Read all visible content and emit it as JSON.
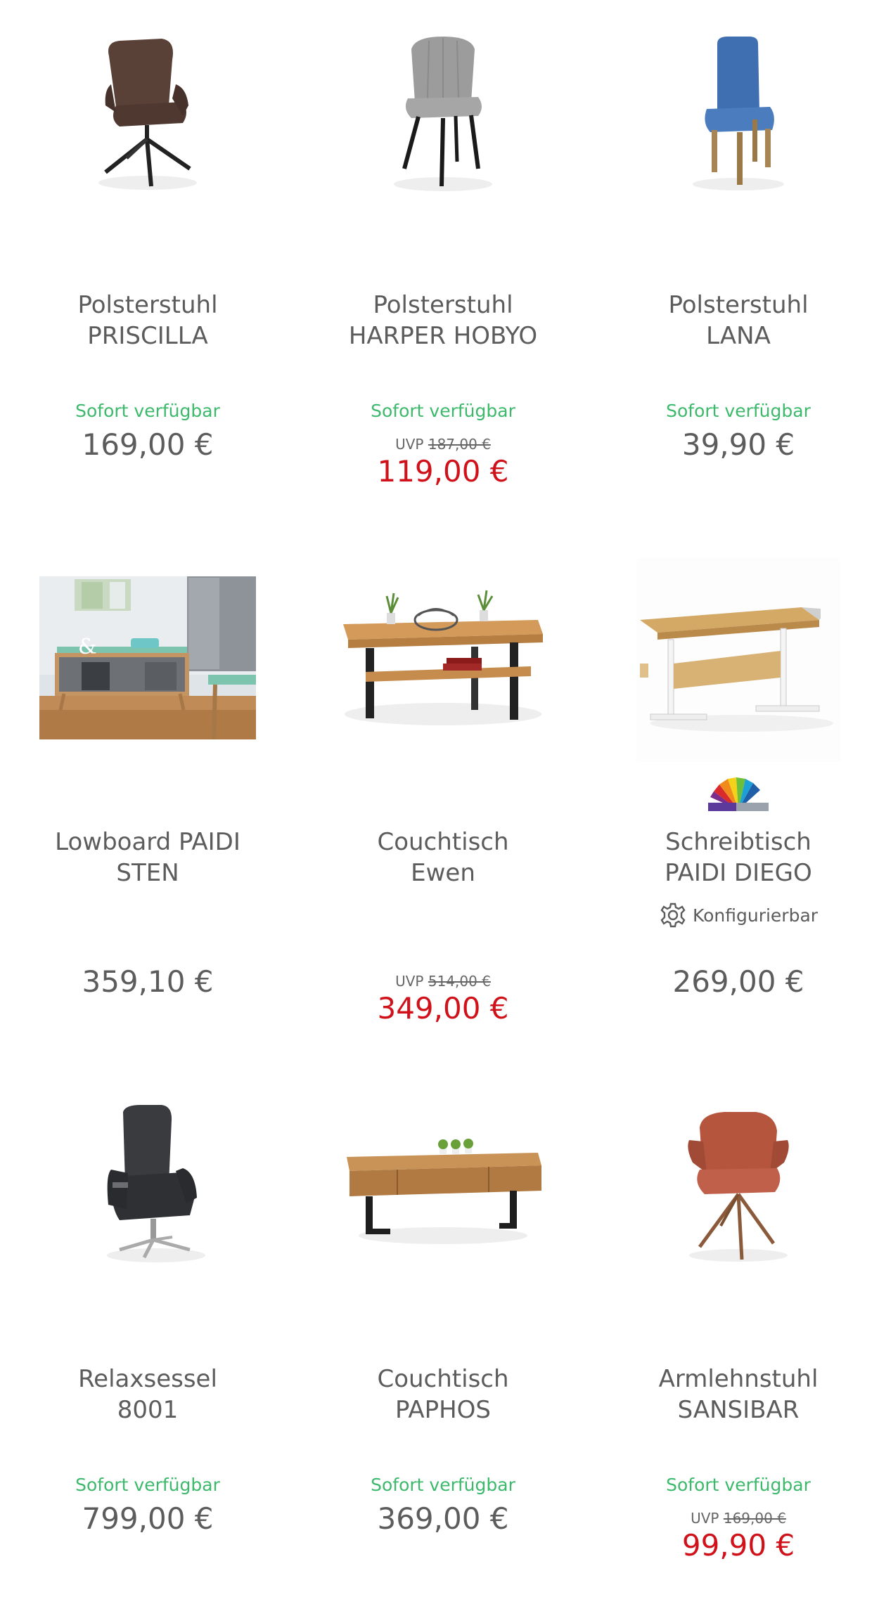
{
  "products": [
    {
      "line1": "Polsterstuhl",
      "line2": "PRISCILLA",
      "availability": "Sofort verfügbar",
      "uvp_label": "",
      "uvp_price": "",
      "price": "169,00 €",
      "sale": false,
      "configurable": ""
    },
    {
      "line1": "Polsterstuhl",
      "line2": "HARPER HOBYO",
      "availability": "Sofort verfügbar",
      "uvp_label": "UVP",
      "uvp_price": "187,00 €",
      "price": "119,00 €",
      "sale": true,
      "configurable": ""
    },
    {
      "line1": "Polsterstuhl",
      "line2": "LANA",
      "availability": "Sofort verfügbar",
      "uvp_label": "",
      "uvp_price": "",
      "price": "39,90 €",
      "sale": false,
      "configurable": ""
    },
    {
      "line1": "Lowboard PAIDI",
      "line2": "STEN",
      "availability": "",
      "uvp_label": "",
      "uvp_price": "",
      "price": "359,10 €",
      "sale": false,
      "configurable": ""
    },
    {
      "line1": "Couchtisch",
      "line2": "Ewen",
      "availability": "",
      "uvp_label": "UVP",
      "uvp_price": "514,00 €",
      "price": "349,00 €",
      "sale": true,
      "configurable": ""
    },
    {
      "line1": "Schreibtisch",
      "line2": "PAIDI DIEGO",
      "availability": "",
      "uvp_label": "",
      "uvp_price": "",
      "price": "269,00 €",
      "sale": false,
      "configurable": "Konfigurierbar"
    },
    {
      "line1": "Relaxsessel",
      "line2": "8001",
      "availability": "Sofort verfügbar",
      "uvp_label": "",
      "uvp_price": "",
      "price": "799,00 €",
      "sale": false,
      "configurable": ""
    },
    {
      "line1": "Couchtisch",
      "line2": "PAPHOS",
      "availability": "Sofort verfügbar",
      "uvp_label": "",
      "uvp_price": "",
      "price": "369,00 €",
      "sale": false,
      "configurable": ""
    },
    {
      "line1": "Armlehnstuhl",
      "line2": "SANSIBAR",
      "availability": "Sofort verfügbar",
      "uvp_label": "UVP",
      "uvp_price": "169,00 €",
      "price": "99,90 €",
      "sale": true,
      "configurable": ""
    }
  ],
  "colors": {
    "available": "#3cb96b",
    "sale": "#d0111a",
    "text": "#5c5c5c",
    "divider": "#e6e6e6"
  },
  "icons": {
    "configurable": "gear-icon",
    "color-swatch": "color-fan-icon"
  }
}
